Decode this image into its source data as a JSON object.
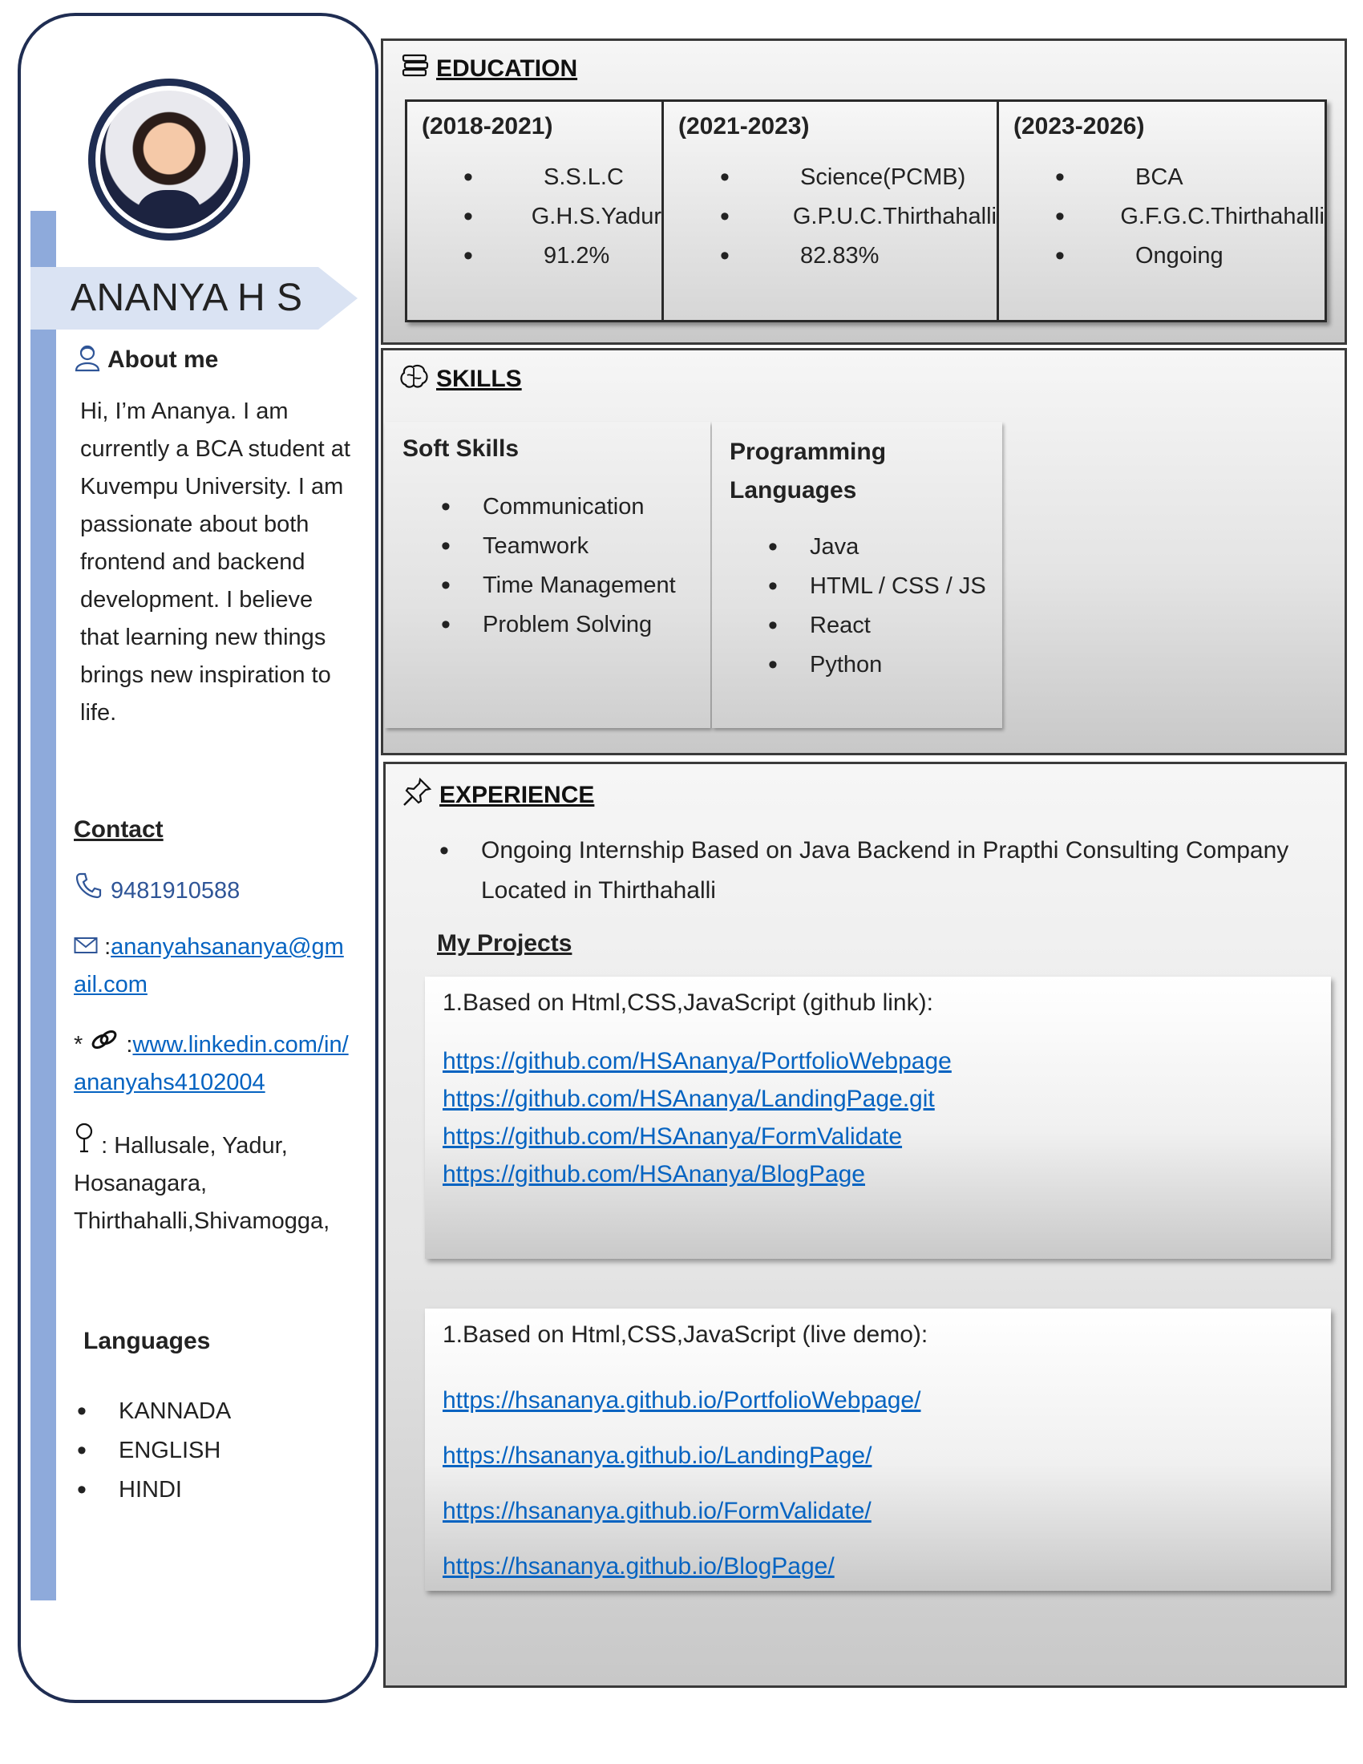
{
  "profile": {
    "name": "ANANYA H S",
    "about_title": "About me",
    "about_text": "Hi, I’m Ananya. I am currently a BCA student at Kuvempu University. I am passionate about both frontend and backend development. I believe that learning new things brings new inspiration to life."
  },
  "contact": {
    "title": "Contact",
    "phone": "9481910588",
    "email_prefix": ":",
    "email": "ananyahsananya@gmail.com",
    "linkedin_prefix": "*",
    "linkedin_sep": ":",
    "linkedin": "www.linkedin.com/in/ananyahs4102004",
    "address_prefix": ":",
    "address": "Hallusale, Yadur, Hosanagara, Thirthahalli,Shivamogga,"
  },
  "languages": {
    "title": "Languages",
    "items": [
      "KANNADA",
      "ENGLISH",
      "HINDI"
    ]
  },
  "education": {
    "title": "EDUCATION",
    "columns": [
      {
        "years": "(2018-2021)",
        "items": [
          "S.S.L.C",
          "G.H.S.Yadur",
          "91.2%"
        ]
      },
      {
        "years": "(2021-2023)",
        "items": [
          "Science(PCMB)",
          "G.P.U.C.Thirthahalli",
          "82.83%"
        ]
      },
      {
        "years": "(2023-2026)",
        "items": [
          "BCA",
          "G.F.G.C.Thirthahalli",
          "Ongoing"
        ]
      }
    ]
  },
  "skills": {
    "title": "SKILLS",
    "soft": {
      "title": "Soft Skills",
      "items": [
        "Communication",
        "Teamwork",
        "Time Management",
        " Problem Solving"
      ]
    },
    "programming": {
      "title_line1": "Programming",
      "title_line2": "Languages",
      "items": [
        "Java",
        "HTML / CSS / JS",
        "React",
        "Python"
      ]
    }
  },
  "experience": {
    "title": "EXPERIENCE",
    "item": "Ongoing Internship  Based on Java Backend in Prapthi Consulting Company Located in Thirthahalli",
    "projects_title": "My Projects",
    "github_heading": "1.Based on Html,CSS,JavaScript (github link):",
    "github_links": [
      "https://github.com/HSAnanya/PortfolioWebpage",
      "https://github.com/HSAnanya/LandingPage.git",
      "https://github.com/HSAnanya/FormValidate",
      "https://github.com/HSAnanya/BlogPage"
    ],
    "demo_heading": "1.Based on Html,CSS,JavaScript (live demo):",
    "demo_links": [
      "https://hsananya.github.io/PortfolioWebpage/",
      "https://hsananya.github.io/LandingPage/",
      "https://hsananya.github.io/FormValidate/",
      "https://hsananya.github.io/BlogPage/"
    ]
  },
  "icons": {
    "about": "person-icon",
    "phone": "phone-icon",
    "email": "envelope-icon",
    "linkedin": "link-icon",
    "address": "location-pin-icon",
    "education": "books-icon",
    "skills": "brain-icon",
    "experience": "pushpin-icon"
  },
  "colors": {
    "frame": "#1f2d52",
    "side_bar": "#8eaadb",
    "name_banner": "#dae3f3",
    "link": "#0563c1",
    "phone_text": "#2f5597"
  }
}
